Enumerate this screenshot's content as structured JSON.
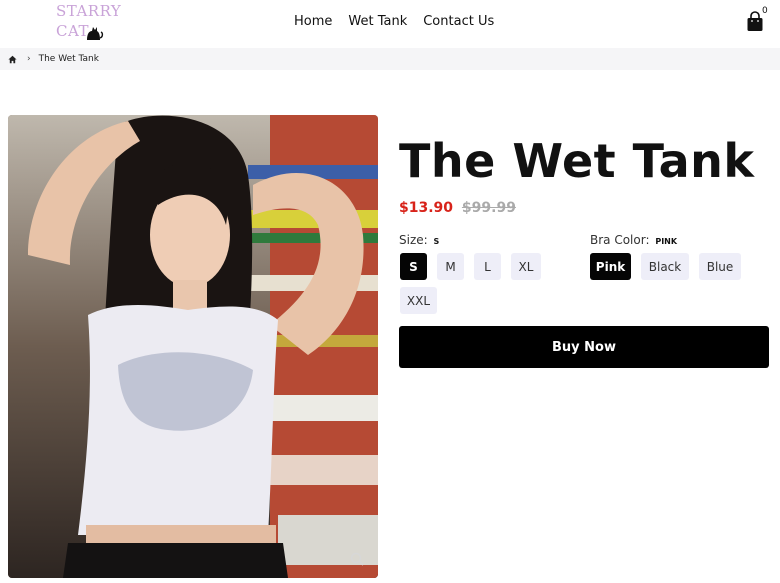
{
  "brand": {
    "line1": "STARRY",
    "line2": "CAT",
    "color": "#c9a3d8"
  },
  "nav": {
    "items": [
      "Home",
      "Wet Tank",
      "Contact Us"
    ]
  },
  "cart": {
    "count": "0",
    "icon": "shopping-bag-icon"
  },
  "breadcrumb": {
    "home_icon": "home-icon",
    "separator": "›",
    "current": "The Wet Tank"
  },
  "product": {
    "title": "The Wet Tank",
    "price_sale": "$13.90",
    "price_original": "$99.99",
    "image_icon": "zoom-icon",
    "size": {
      "label": "Size:",
      "selected": "S",
      "options": [
        "S",
        "M",
        "L",
        "XL",
        "XXL"
      ]
    },
    "bra_color": {
      "label": "Bra Color:",
      "selected": "PINK",
      "options": [
        "Pink",
        "Black",
        "Blue"
      ]
    },
    "buy_label": "Buy Now",
    "colors": {
      "sale": "#d8231a",
      "original": "#aaaaaa",
      "option_bg": "#eeeef8",
      "active_bg": "#050505"
    }
  }
}
